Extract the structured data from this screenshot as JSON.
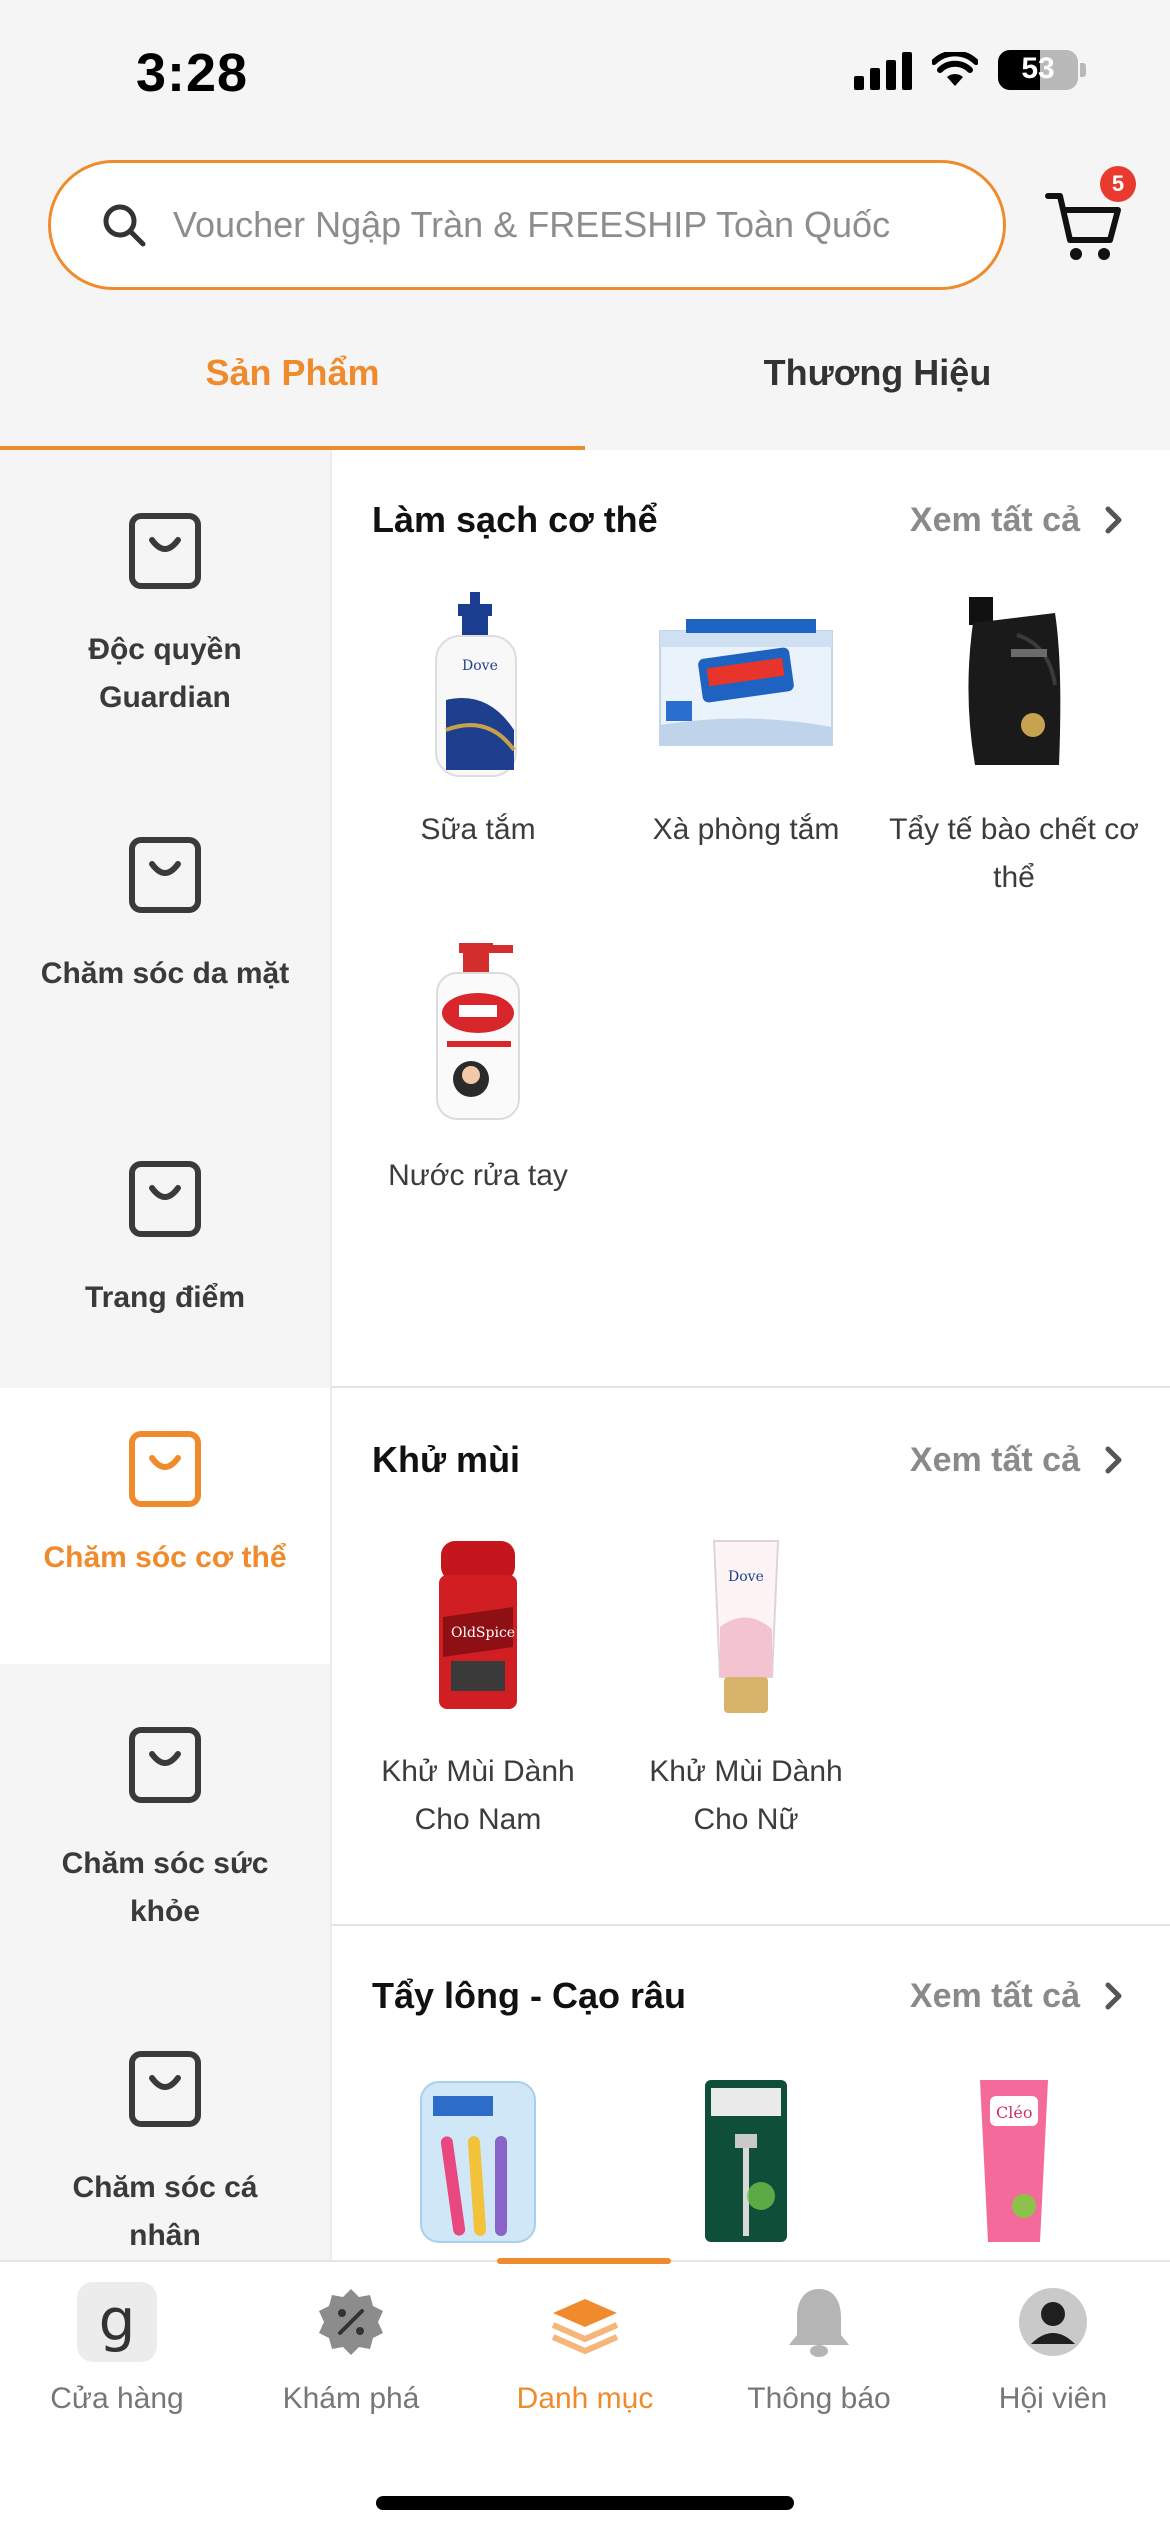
{
  "status_bar": {
    "time": "3:28",
    "battery": "53"
  },
  "search": {
    "placeholder": "Voucher Ngập Tràn & FREESHIP Toàn Quốc",
    "value": ""
  },
  "cart": {
    "badge_count": "5"
  },
  "tabs": [
    {
      "label": "Sản Phẩm",
      "active": true
    },
    {
      "label": "Thương Hiệu",
      "active": false
    }
  ],
  "sidebar": {
    "items": [
      {
        "label": "Độc quyền Guardian",
        "icon": "shopping-bag-icon",
        "active": false
      },
      {
        "label": "Chăm sóc da mặt",
        "icon": "shopping-bag-icon",
        "active": false
      },
      {
        "label": "Trang điểm",
        "icon": "shopping-bag-icon",
        "active": false
      },
      {
        "label": "Chăm sóc cơ thể",
        "icon": "shopping-bag-icon",
        "active": true
      },
      {
        "label": "Chăm sóc sức khỏe",
        "icon": "shopping-bag-icon",
        "active": false
      },
      {
        "label": "Chăm sóc cá nhân",
        "icon": "shopping-bag-icon",
        "active": false
      }
    ]
  },
  "sections": [
    {
      "title": "Làm sạch cơ thể",
      "see_all": "Xem tất cả",
      "products": [
        {
          "name": "Sữa tắm",
          "image": "dove-body-wash-bottle"
        },
        {
          "name": "Xà phòng tắm",
          "image": "safeguard-soap-pack"
        },
        {
          "name": "Tẩy tế bào chết cơ thể",
          "image": "black-refill-pouch"
        },
        {
          "name": "Nước rửa tay",
          "image": "lifebuoy-hand-wash"
        }
      ]
    },
    {
      "title": "Khử mùi",
      "see_all": "Xem tất cả",
      "products": [
        {
          "name": "Khử Mùi Dành Cho Nam",
          "image": "old-spice-deodorant"
        },
        {
          "name": "Khử Mùi Dành Cho Nữ",
          "image": "dove-deodorant-tube"
        }
      ]
    },
    {
      "title": "Tẩy lông - Cạo râu",
      "see_all": "Xem tất cả",
      "products": [
        {
          "name": "",
          "image": "venus-razors-pack"
        },
        {
          "name": "",
          "image": "gillette-vector-razor"
        },
        {
          "name": "",
          "image": "cleo-hair-removal-cream"
        }
      ]
    }
  ],
  "bottom_nav": [
    {
      "label": "Cửa hàng",
      "icon": "store-g-icon",
      "active": false
    },
    {
      "label": "Khám phá",
      "icon": "discount-badge-icon",
      "active": false
    },
    {
      "label": "Danh mục",
      "icon": "layers-icon",
      "active": true
    },
    {
      "label": "Thông báo",
      "icon": "bell-icon",
      "active": false
    },
    {
      "label": "Hội viên",
      "icon": "user-avatar-icon",
      "active": false
    }
  ],
  "colors": {
    "accent": "#ef8b2c",
    "badge": "#e83a2f",
    "sidebar_bg": "#f5f5f5"
  }
}
